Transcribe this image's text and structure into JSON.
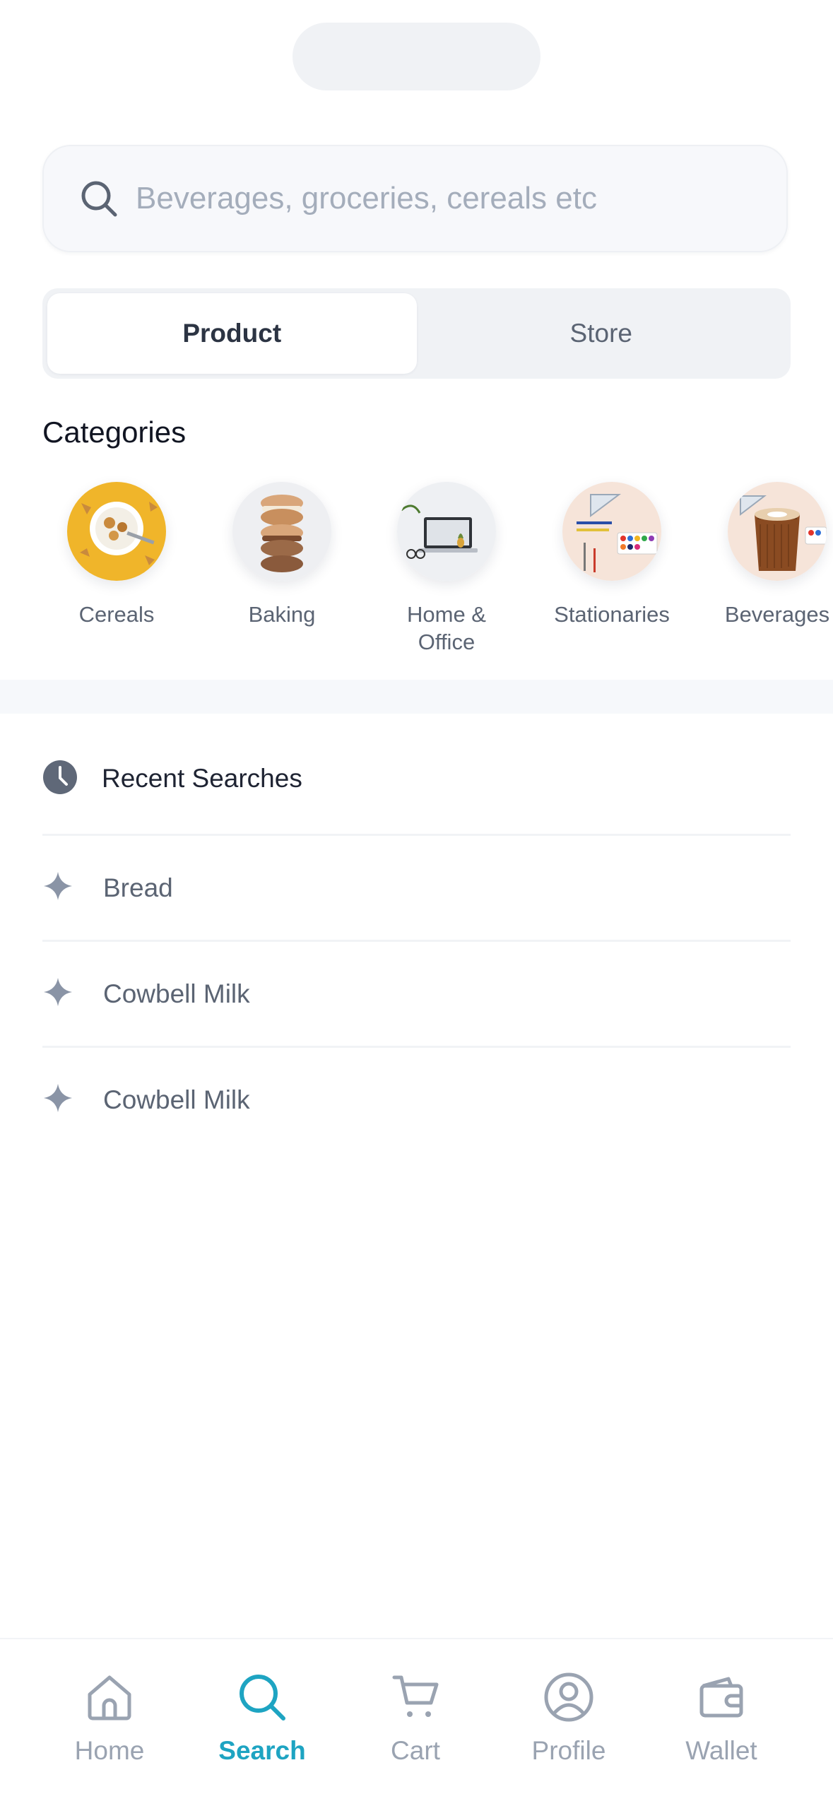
{
  "search": {
    "placeholder": "Beverages, groceries, cereals etc"
  },
  "segments": [
    {
      "label": "Product",
      "active": true
    },
    {
      "label": "Store",
      "active": false
    }
  ],
  "categories": {
    "title": "Categories",
    "items": [
      {
        "label": "Cereals",
        "icon": "cereal-bowl-image"
      },
      {
        "label": "Baking",
        "icon": "macarons-image"
      },
      {
        "label": "Home &\nOffice",
        "icon": "laptop-desk-image"
      },
      {
        "label": "Stationaries",
        "icon": "stationery-image"
      },
      {
        "label": "Beverages",
        "icon": "coffee-cup-image"
      }
    ]
  },
  "recent": {
    "title": "Recent Searches",
    "items": [
      {
        "label": "Bread"
      },
      {
        "label": "Cowbell Milk"
      },
      {
        "label": "Cowbell Milk"
      }
    ]
  },
  "tabbar": {
    "tabs": [
      {
        "label": "Home",
        "icon": "home-icon",
        "active": false
      },
      {
        "label": "Search",
        "icon": "search-icon",
        "active": true
      },
      {
        "label": "Cart",
        "icon": "cart-icon",
        "active": false
      },
      {
        "label": "Profile",
        "icon": "profile-icon",
        "active": false
      },
      {
        "label": "Wallet",
        "icon": "wallet-icon",
        "active": false
      }
    ]
  },
  "colors": {
    "accent": "#1ea4c2",
    "muted": "#9aa3b1",
    "text": "#1f2433"
  }
}
